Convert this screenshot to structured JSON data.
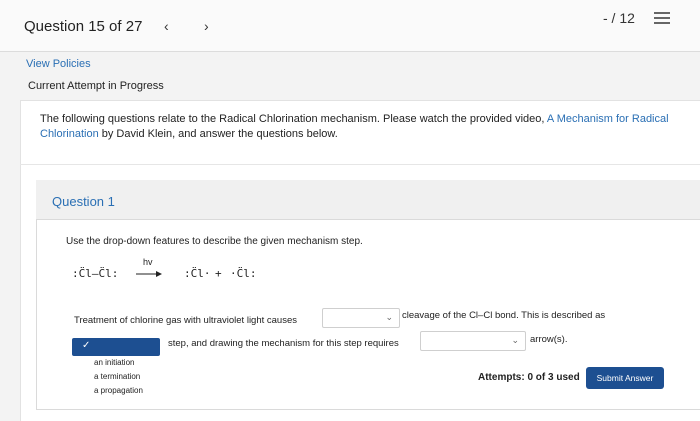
{
  "header": {
    "progress": "Question 15 of 27",
    "prev_icon": "chevron-left-icon",
    "next_icon": "chevron-right-icon",
    "score": "- / 12",
    "menu_icon": "list-menu-icon"
  },
  "links": {
    "view_policies": "View Policies"
  },
  "status": {
    "attempt": "Current Attempt in Progress"
  },
  "intro": {
    "text_before": "The following questions relate to the Radical Chlorination mechanism. Please watch the provided video, ",
    "link": "A Mechanism for Radical Chlorination",
    "text_after": " by David Klein, and answer the questions below."
  },
  "question": {
    "title": "Question 1",
    "instruction": "Use the drop-down features to describe the given mechanism step.",
    "mechanism": {
      "reactant": ":C̈l–C̈l:",
      "condition": "hv",
      "product_1": ":C̈l·",
      "plus": "+",
      "product_2": "·C̈l:"
    },
    "sentence_1a": "Treatment of chlorine gas with ultraviolet light causes",
    "sentence_1b": "cleavage of the Cl–Cl bond. This is described as",
    "sentence_2": "step, and drawing the mechanism for this step requires",
    "sentence_3": "arrow(s).",
    "dropdown_open_selected": "✓",
    "dropdown_options": [
      "an initiation",
      "a termination",
      "a propagation"
    ]
  },
  "footer": {
    "attempts": "Attempts: 0 of 3 used",
    "submit": "Submit Answer"
  },
  "colors": {
    "accent": "#1d4f91",
    "link": "#2a6fb4"
  }
}
